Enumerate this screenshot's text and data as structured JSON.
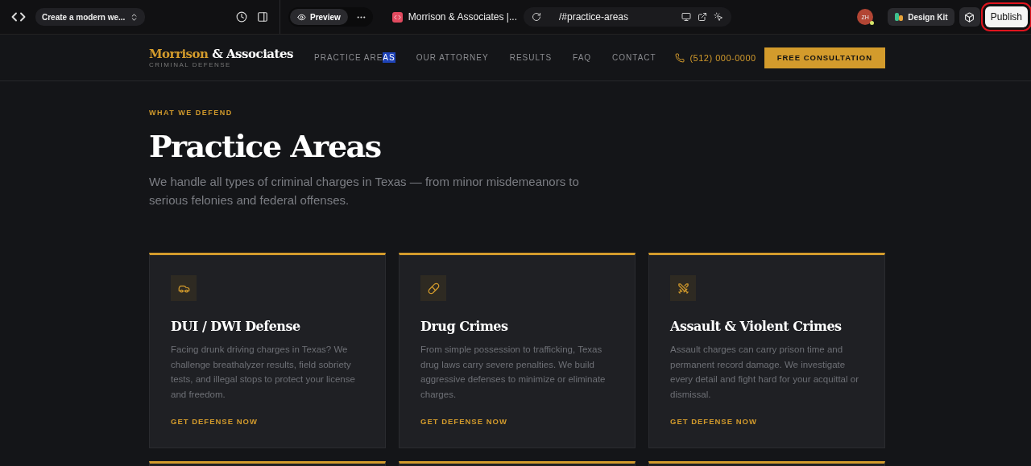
{
  "editor_bar": {
    "project": "Create a modern we...",
    "preview": "Preview",
    "page_title": "Morrison & Associates |...",
    "url": "/#practice-areas",
    "avatar": "ZH",
    "design_kit": "Design Kit",
    "publish": {
      "label": "Publish",
      "highlighted": true
    }
  },
  "site_nav": {
    "brand_first": "Morrison",
    "brand_rest": "& Associates",
    "tagline": "CRIMINAL DEFENSE",
    "links": [
      {
        "label": "PRACTICE ARE",
        "selected_text": "AS"
      },
      {
        "label": "OUR ATTORNEY"
      },
      {
        "label": "RESULTS"
      },
      {
        "label": "FAQ"
      },
      {
        "label": "CONTACT"
      }
    ],
    "phone": "(512) 000-0000",
    "cta": "FREE CONSULTATION"
  },
  "hero": {
    "eyebrow": "WHAT WE DEFEND",
    "title": "Practice Areas",
    "subtitle": "We handle all types of criminal charges in Texas — from minor misdemeanors to serious felonies and federal offenses."
  },
  "cards": [
    {
      "kind": "full",
      "title": "DUI / DWI Defense",
      "text": "Facing drunk driving charges in Texas? We challenge breathalyzer results, field sobriety tests, and illegal stops to protect your license and freedom.",
      "link": "GET DEFENSE NOW"
    },
    {
      "kind": "full",
      "title": "Drug Crimes",
      "text": "From simple possession to trafficking, Texas drug laws carry severe penalties. We build aggressive defenses to minimize or eliminate charges.",
      "link": "GET DEFENSE NOW"
    },
    {
      "kind": "full",
      "title": "Assault & Violent Crimes",
      "text": "Assault charges can carry prison time and permanent record damage. We investigate every detail and fight hard for your acquittal or dismissal.",
      "link": "GET DEFENSE NOW"
    },
    {
      "kind": "cut_off"
    },
    {
      "kind": "cut_off"
    },
    {
      "kind": "cut_off"
    }
  ]
}
